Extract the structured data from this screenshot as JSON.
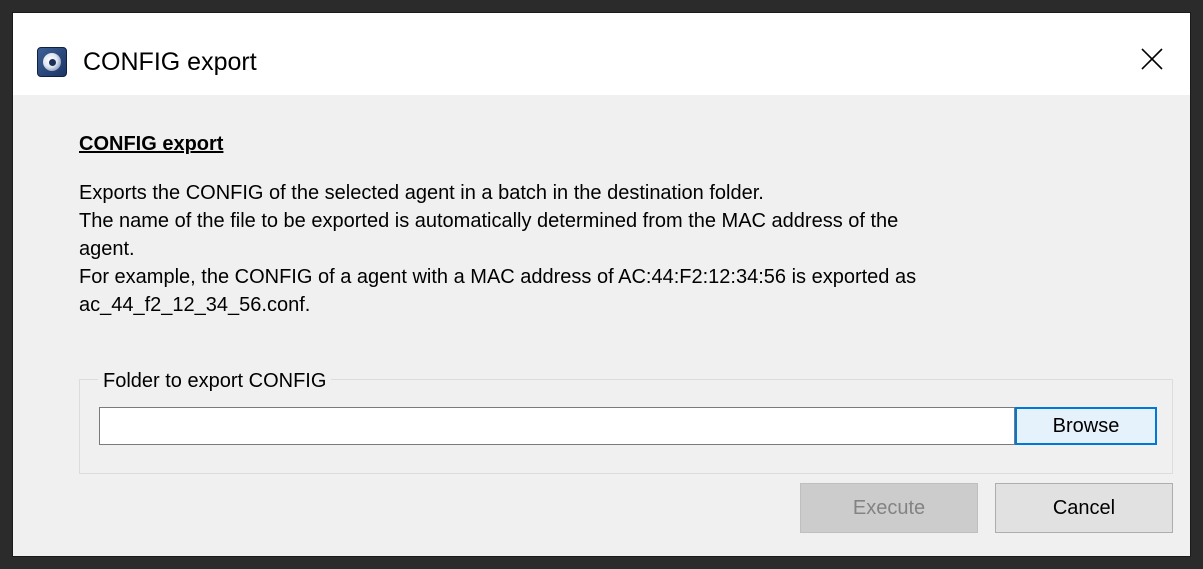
{
  "window": {
    "title": "CONFIG export",
    "close_icon": "close-icon",
    "app_icon": "app-icon"
  },
  "content": {
    "heading": "CONFIG export",
    "description_lines": [
      "Exports the CONFIG of the selected agent in a batch in the destination folder.",
      "The name of the file to be exported is automatically determined from the MAC address of the",
      "agent.",
      "For example, the CONFIG of a agent with a MAC address of AC:44:F2:12:34:56 is exported as",
      "ac_44_f2_12_34_56.conf."
    ]
  },
  "folder_group": {
    "legend": "Folder to export CONFIG",
    "input_value": "",
    "browse_label": "Browse"
  },
  "actions": {
    "execute_label": "Execute",
    "execute_enabled": false,
    "cancel_label": "Cancel"
  },
  "colors": {
    "focus_border": "#0078d7",
    "dialog_background": "#f0f0f0",
    "titlebar_background": "#ffffff"
  }
}
